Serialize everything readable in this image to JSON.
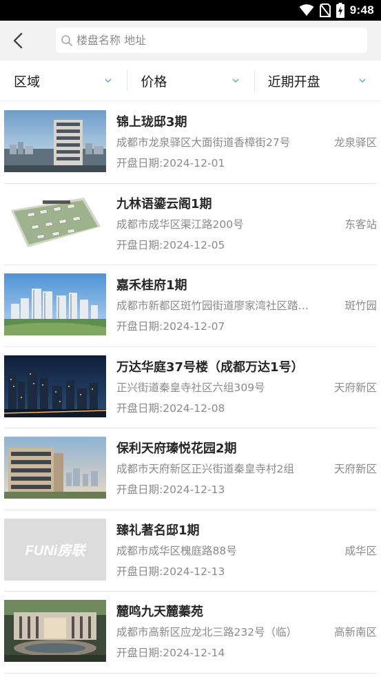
{
  "status_bar": {
    "time": "9:48"
  },
  "search": {
    "placeholder": "楼盘名称 地址"
  },
  "filters": [
    {
      "label": "区域"
    },
    {
      "label": "价格"
    },
    {
      "label": "近期开盘"
    }
  ],
  "date_prefix": "开盘日期:",
  "listings": [
    {
      "name": "锦上珑邸3期",
      "address": "成都市龙泉驿区大面街道香樟街27号",
      "district": "龙泉驿区",
      "date": "开盘日期:2024-12-01",
      "image": "highrise-city-photo"
    },
    {
      "name": "九林语鎏云阁1期",
      "address": "成都市成华区渠江路200号",
      "district": "东客站",
      "date": "开盘日期:2024-12-05",
      "image": "site-plan-aerial"
    },
    {
      "name": "嘉禾桂府1期",
      "address": "成都市新都区斑竹园街道廖家湾社区踏…",
      "district": "斑竹园",
      "date": "开盘日期:2024-12-07",
      "image": "residential-towers-photo"
    },
    {
      "name": "万达华庭37号楼（成都万达1号）",
      "address": "正兴街道秦皇寺社区六组309号",
      "district": "天府新区",
      "date": "开盘日期:2024-12-08",
      "image": "night-city-photo"
    },
    {
      "name": "保利天府瑧悦花园2期",
      "address": "成都市天府新区正兴街道秦皇寺村2组",
      "district": "天府新区",
      "date": "开盘日期:2024-12-13",
      "image": "building-render"
    },
    {
      "name": "臻礼著名邸1期",
      "address": "成都市成华区槐庭路88号",
      "district": "成华区",
      "date": "开盘日期:2024-12-13",
      "image": "placeholder-logo",
      "logo_text": "FUNi房联"
    },
    {
      "name": "麓鸣九天麓蓁苑",
      "address": "成都市高新区应龙北三路232号（临）",
      "district": "高新南区",
      "date": "开盘日期:2024-12-14",
      "image": "plaza-render"
    }
  ],
  "colors": {
    "header_bg": "#f2f2f2",
    "title": "#262626",
    "muted": "#8a8a8a",
    "accent": "#4da6d9"
  }
}
